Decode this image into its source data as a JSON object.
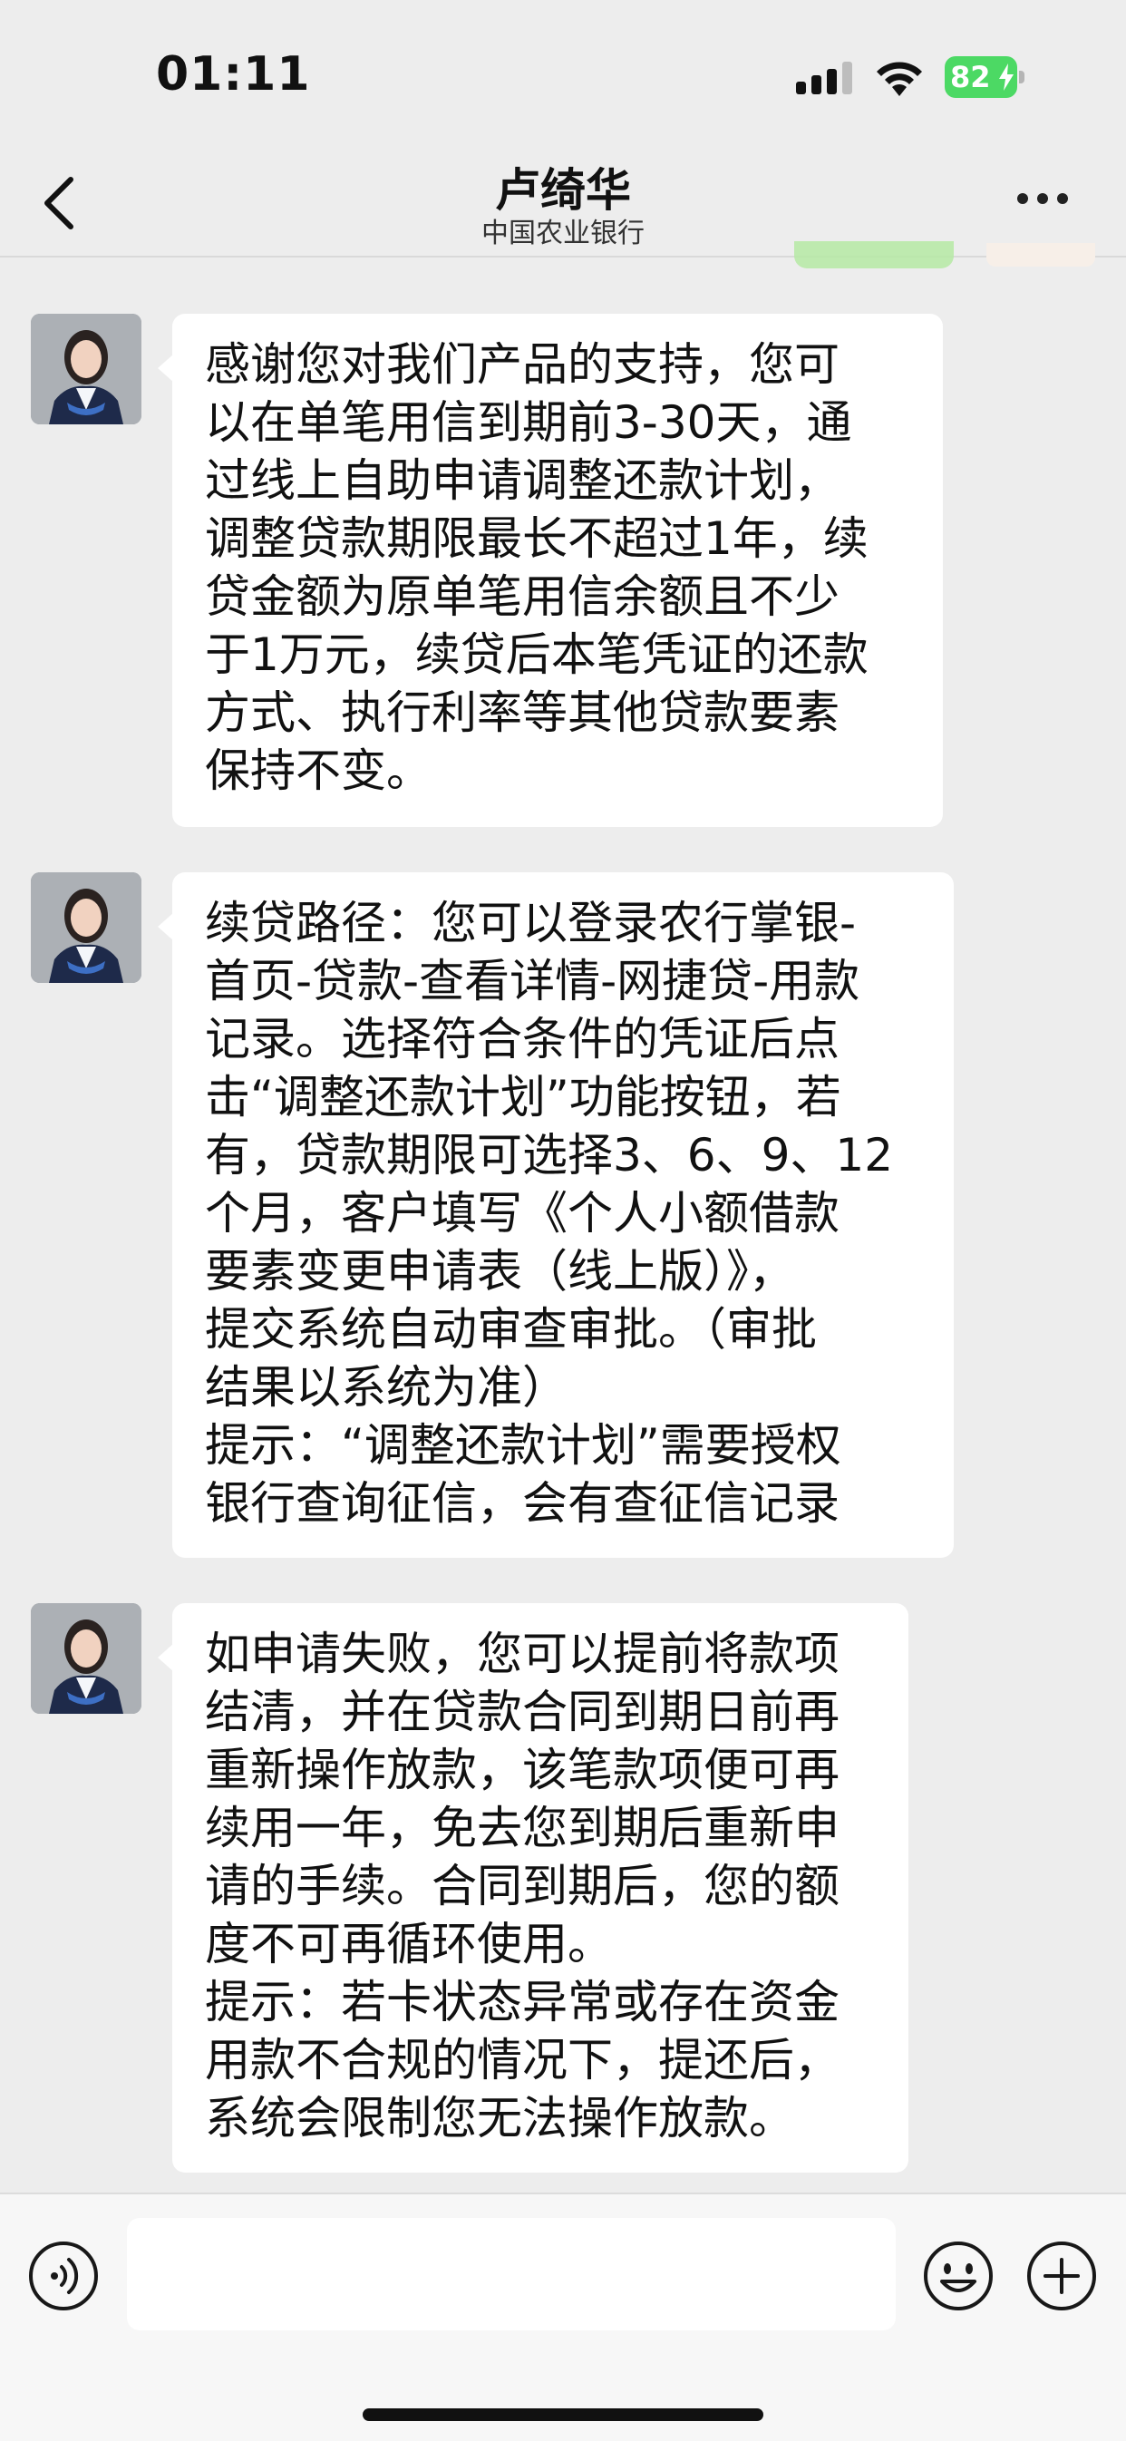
{
  "status_bar": {
    "time": "01:11",
    "battery": "82"
  },
  "header": {
    "title": "卢绮华",
    "subtitle": "中国农业银行"
  },
  "messages": [
    {
      "sender": "卢绮华",
      "text": "感谢您对我们产品的支持，您可\n以在单笔用信到期前3-30天，通\n过线上自助申请调整还款计划，\n调整贷款期限最长不超过1年，续\n贷金额为原单笔用信余额且不少\n于1万元，续贷后本笔凭证的还款\n方式、执行利率等其他贷款要素\n保持不变。"
    },
    {
      "sender": "卢绮华",
      "text": "续贷路径：您可以登录农行掌银-\n首页-贷款-查看详情-网捷贷-用款\n记录。选择符合条件的凭证后点\n击“调整还款计划”功能按钮，若\n有，贷款期限可选择3、6、9、12\n个月，客户填写《个人小额借款\n要素变更申请表（线上版）》，\n提交系统自动审查审批。（审批\n结果以系统为准）\n提示：“调整还款计划”需要授权\n银行查询征信，会有查征信记录"
    },
    {
      "sender": "卢绮华",
      "text": "如申请失败，您可以提前将款项\n结清，并在贷款合同到期日前再\n重新操作放款，该笔款项便可再\n续用一年，免去您到期后重新申\n请的手续。合同到期后，您的额\n度不可再循环使用。\n提示：若卡状态异常或存在资金\n用款不合规的情况下，提还后，\n系统会限制您无法操作放款。"
    }
  ],
  "input": {
    "value": ""
  }
}
